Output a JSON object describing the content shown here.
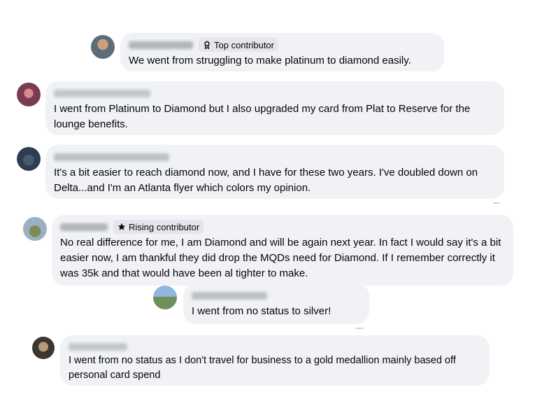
{
  "comments": [
    {
      "badge": "Top contributor",
      "badge_icon": "ribbon-icon",
      "text": "We went from struggling to make platinum to diamond easily."
    },
    {
      "badge": "",
      "text": "I went from Platinum to Diamond but I also upgraded my card from Plat to Reserve for the lounge benefits."
    },
    {
      "badge": "",
      "text": "It's a bit easier to reach diamond now, and I have for these two years. I've doubled down on Delta...and I'm an Atlanta flyer which colors my opinion."
    },
    {
      "badge": "Rising contributor",
      "badge_icon": "star-icon",
      "text": "No real difference for me, I am Diamond and will be again next year. In fact I would say it's a bit easier now, I am thankful they did drop the MQDs need for Diamond. If I remember correctly it was 35k and that would have been al tighter to make."
    },
    {
      "badge": "",
      "text": "I went from no status to silver!"
    },
    {
      "badge": "",
      "text": "I went from no status as I don't travel for business to a gold medallion mainly based off personal card spend"
    }
  ],
  "colors": {
    "bubble": "#f0f2f5",
    "badge_bg": "#e4e6eb",
    "text": "#050505"
  }
}
